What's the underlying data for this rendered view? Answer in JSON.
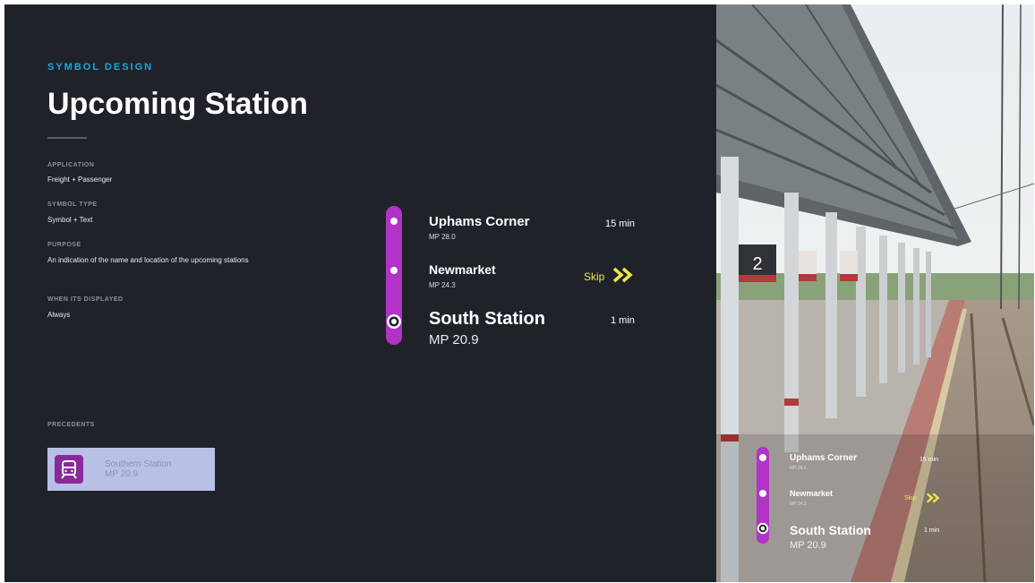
{
  "header": {
    "eyebrow": "SYMBOL DESIGN",
    "title": "Upcoming Station"
  },
  "meta": [
    {
      "label": "APPLICATION",
      "value": "Freight + Passenger"
    },
    {
      "label": "SYMBOL TYPE",
      "value": "Symbol + Text"
    },
    {
      "label": "PURPOSE",
      "value": "An indication of the name and location of the upcoming stations"
    },
    {
      "label": "WHEN ITS DISPLAYED",
      "value": "Always"
    }
  ],
  "precedents": {
    "label": "PRECEDENTS",
    "card_line1": "Southern Station",
    "card_line2": "MP 20.9"
  },
  "stations": [
    {
      "name": "Uphams Corner",
      "mp": "MP 28.0",
      "status": "15 min"
    },
    {
      "name": "Newmarket",
      "mp": "MP 24.3",
      "status": "Skip"
    },
    {
      "name": "South Station",
      "mp": "MP 20.9",
      "status": "1 min"
    }
  ],
  "photo": {
    "platform_number": "2"
  },
  "colors": {
    "background": "#1f2329",
    "accent_blue": "#1fa6dd",
    "route_magenta": "#b233c7",
    "skip_yellow": "#f0e84a"
  }
}
